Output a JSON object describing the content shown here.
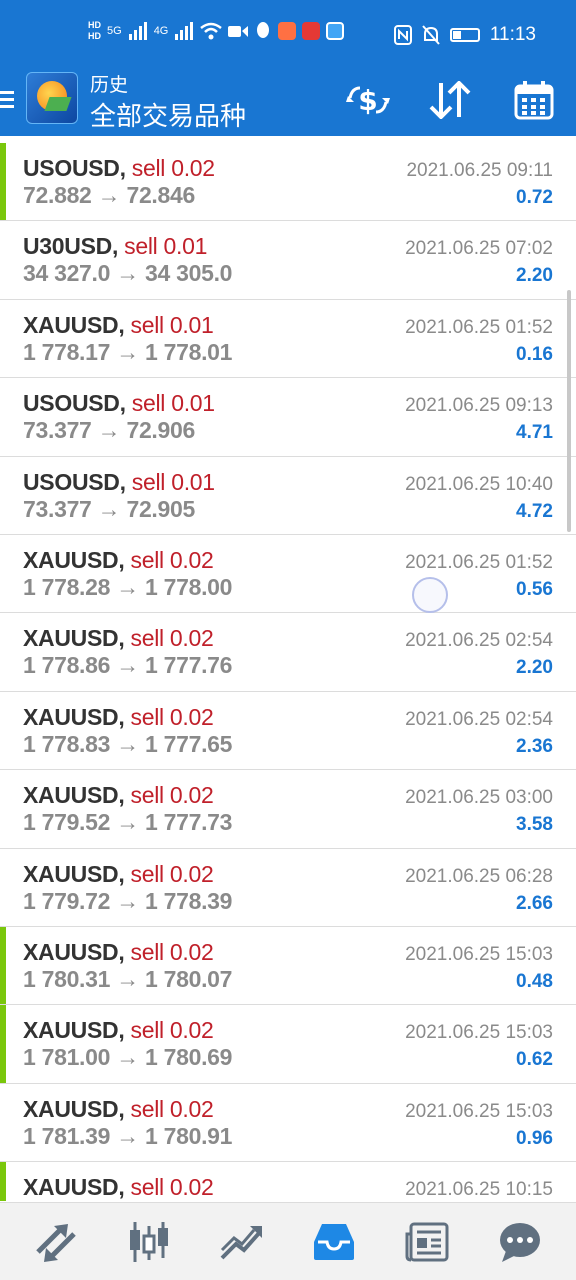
{
  "status_bar": {
    "hd1": "HD",
    "hd2": "HD",
    "net1": "5G",
    "net2": "4G",
    "time": "11:13"
  },
  "app_bar": {
    "title_small": "历史",
    "title_big": "全部交易品种"
  },
  "colors": {
    "primary": "#1976d2",
    "sell": "#c0202a",
    "profit": "#1976d2",
    "marker": "#7ac70c"
  },
  "trades": [
    {
      "symbol": "USOUSD,",
      "side": "sell 0.02",
      "open": "72.882",
      "arrow": "→",
      "close": "72.846",
      "time": "2021.06.25 09:11",
      "profit": "0.72",
      "marked": true
    },
    {
      "symbol": "U30USD,",
      "side": "sell 0.01",
      "open": "34 327.0",
      "arrow": "→",
      "close": "34 305.0",
      "time": "2021.06.25 07:02",
      "profit": "2.20",
      "marked": false
    },
    {
      "symbol": "XAUUSD,",
      "side": "sell 0.01",
      "open": "1 778.17",
      "arrow": "→",
      "close": "1 778.01",
      "time": "2021.06.25 01:52",
      "profit": "0.16",
      "marked": false
    },
    {
      "symbol": "USOUSD,",
      "side": "sell 0.01",
      "open": "73.377",
      "arrow": "→",
      "close": "72.906",
      "time": "2021.06.25 09:13",
      "profit": "4.71",
      "marked": false
    },
    {
      "symbol": "USOUSD,",
      "side": "sell 0.01",
      "open": "73.377",
      "arrow": "→",
      "close": "72.905",
      "time": "2021.06.25 10:40",
      "profit": "4.72",
      "marked": false
    },
    {
      "symbol": "XAUUSD,",
      "side": "sell 0.02",
      "open": "1 778.28",
      "arrow": "→",
      "close": "1 778.00",
      "time": "2021.06.25 01:52",
      "profit": "0.56",
      "marked": false
    },
    {
      "symbol": "XAUUSD,",
      "side": "sell 0.02",
      "open": "1 778.86",
      "arrow": "→",
      "close": "1 777.76",
      "time": "2021.06.25 02:54",
      "profit": "2.20",
      "marked": false
    },
    {
      "symbol": "XAUUSD,",
      "side": "sell 0.02",
      "open": "1 778.83",
      "arrow": "→",
      "close": "1 777.65",
      "time": "2021.06.25 02:54",
      "profit": "2.36",
      "marked": false
    },
    {
      "symbol": "XAUUSD,",
      "side": "sell 0.02",
      "open": "1 779.52",
      "arrow": "→",
      "close": "1 777.73",
      "time": "2021.06.25 03:00",
      "profit": "3.58",
      "marked": false
    },
    {
      "symbol": "XAUUSD,",
      "side": "sell 0.02",
      "open": "1 779.72",
      "arrow": "→",
      "close": "1 778.39",
      "time": "2021.06.25 06:28",
      "profit": "2.66",
      "marked": false
    },
    {
      "symbol": "XAUUSD,",
      "side": "sell 0.02",
      "open": "1 780.31",
      "arrow": "→",
      "close": "1 780.07",
      "time": "2021.06.25 15:03",
      "profit": "0.48",
      "marked": true
    },
    {
      "symbol": "XAUUSD,",
      "side": "sell 0.02",
      "open": "1 781.00",
      "arrow": "→",
      "close": "1 780.69",
      "time": "2021.06.25 15:03",
      "profit": "0.62",
      "marked": true
    },
    {
      "symbol": "XAUUSD,",
      "side": "sell 0.02",
      "open": "1 781.39",
      "arrow": "→",
      "close": "1 780.91",
      "time": "2021.06.25 15:03",
      "profit": "0.96",
      "marked": false
    },
    {
      "symbol": "XAUUSD,",
      "side": "sell 0.02",
      "open": "",
      "arrow": "",
      "close": "",
      "time": "2021.06.25 10:15",
      "profit": "",
      "marked": true
    }
  ],
  "bottom_nav": [
    "quotes-icon",
    "chart-icon",
    "trade-icon",
    "history-icon",
    "news-icon",
    "chat-icon"
  ]
}
